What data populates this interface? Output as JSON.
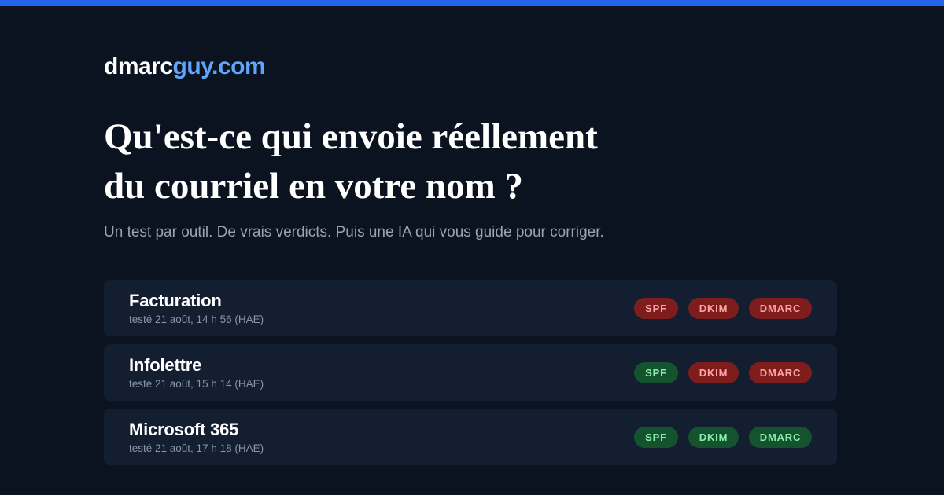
{
  "brand": {
    "part1": "dmarc",
    "part2": "guy.com",
    "accent": "#60a5fa"
  },
  "headline": {
    "line1": "Qu'est-ce qui envoie réellement",
    "line2": "du courriel en votre nom ?"
  },
  "subtitle": "Un test par outil. De vrais verdicts. Puis une IA qui vous guide pour corriger.",
  "colors": {
    "top_bar": "#2563eb",
    "background": "#0b1220",
    "card": "#131e31",
    "fail": "#7f1d1d",
    "pass": "#14532d"
  },
  "rows": [
    {
      "name": "Facturation",
      "tested": "testé 21 août, 14 h 56 (HAE)",
      "checks": [
        {
          "label": "SPF",
          "status": "fail"
        },
        {
          "label": "DKIM",
          "status": "fail"
        },
        {
          "label": "DMARC",
          "status": "fail"
        }
      ]
    },
    {
      "name": "Infolettre",
      "tested": "testé 21 août, 15 h 14 (HAE)",
      "checks": [
        {
          "label": "SPF",
          "status": "pass"
        },
        {
          "label": "DKIM",
          "status": "fail"
        },
        {
          "label": "DMARC",
          "status": "fail"
        }
      ]
    },
    {
      "name": "Microsoft 365",
      "tested": "testé 21 août, 17 h 18 (HAE)",
      "checks": [
        {
          "label": "SPF",
          "status": "pass"
        },
        {
          "label": "DKIM",
          "status": "pass"
        },
        {
          "label": "DMARC",
          "status": "pass"
        }
      ]
    }
  ]
}
